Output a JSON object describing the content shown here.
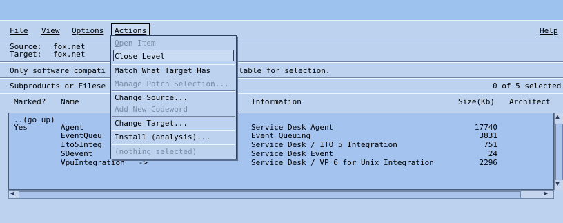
{
  "menubar": {
    "file": "File",
    "view": "View",
    "options": "Options",
    "actions": "Actions",
    "help": "Help"
  },
  "source": {
    "label": "Source:",
    "value": "fox.net"
  },
  "target": {
    "label": "Target:",
    "value": "fox.net"
  },
  "info_message": "Only software compatible with the target is available for selection.",
  "info_left": "Only software compati",
  "info_right": "lable for selection.",
  "subproducts_label": "Subproducts or Filese",
  "selection_count": "0 of 5 selected",
  "columns": {
    "marked": "Marked?",
    "name": "Name",
    "information": "Information",
    "size": "Size(Kb)",
    "architecture": "Architect"
  },
  "rows": [
    {
      "marked": "..(go up)",
      "name": "",
      "info": "",
      "size": ""
    },
    {
      "marked": "Yes",
      "name": "Agent",
      "info": "Service Desk Agent",
      "size": "17740"
    },
    {
      "marked": "",
      "name": "EventQueu",
      "info": "Event Queuing",
      "size": "3831"
    },
    {
      "marked": "",
      "name": "Ito5Integ",
      "info": "Service Desk / ITO 5 Integration",
      "size": "751"
    },
    {
      "marked": "",
      "name": "SDevent",
      "info": "Service Desk Event",
      "size": "24"
    },
    {
      "marked": "",
      "name": "VpuIntegration   ->",
      "info": "Service Desk / VP 6 for Unix Integration",
      "size": "2296"
    }
  ],
  "actions_menu": {
    "open_item": "Open Item",
    "close_level": "Close Level",
    "match_target": "Match What Target Has",
    "manage_patch": "Manage Patch Selection...",
    "change_source": "Change Source...",
    "add_codeword": "Add New Codeword",
    "change_target": "Change Target...",
    "install": "Install (analysis)...",
    "nothing_selected": "(nothing selected)"
  },
  "colors": {
    "background": "#bcd2ee",
    "list_background": "#a5c3ef",
    "top_band": "#9ec2ee",
    "disabled_text": "#7a8ba6"
  }
}
